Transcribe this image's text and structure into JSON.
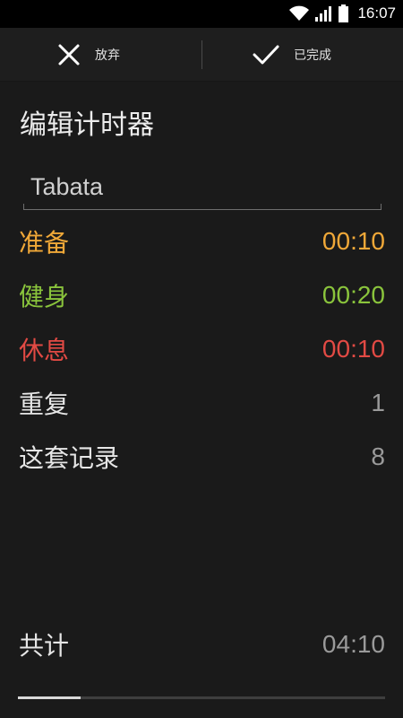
{
  "status_bar": {
    "time": "16:07",
    "icons": [
      "wifi-icon",
      "signal-icon",
      "battery-icon"
    ]
  },
  "action_bar": {
    "discard_label": "放弃",
    "discard_icon": "close-icon",
    "done_label": "已完成",
    "done_icon": "check-icon"
  },
  "page": {
    "title": "编辑计时器"
  },
  "timer_name": {
    "value": "Tabata"
  },
  "settings": [
    {
      "key": "prepare",
      "label": "准备",
      "value": "00:10",
      "color": "#f0a838"
    },
    {
      "key": "work",
      "label": "健身",
      "value": "00:20",
      "color": "#8ac43c"
    },
    {
      "key": "rest",
      "label": "休息",
      "value": "00:10",
      "color": "#e24a44"
    },
    {
      "key": "repeat",
      "label": "重复",
      "value": "1",
      "color": "#e6e6e6"
    },
    {
      "key": "sets",
      "label": "这套记录",
      "value": "8",
      "color": "#e6e6e6"
    }
  ],
  "total": {
    "label": "共计",
    "value": "04:10"
  },
  "progress": {
    "fraction": 0.17
  },
  "colors": {
    "background": "#1a1a1a",
    "status_bar": "#000000",
    "value_neutral": "#9a9a9a"
  }
}
